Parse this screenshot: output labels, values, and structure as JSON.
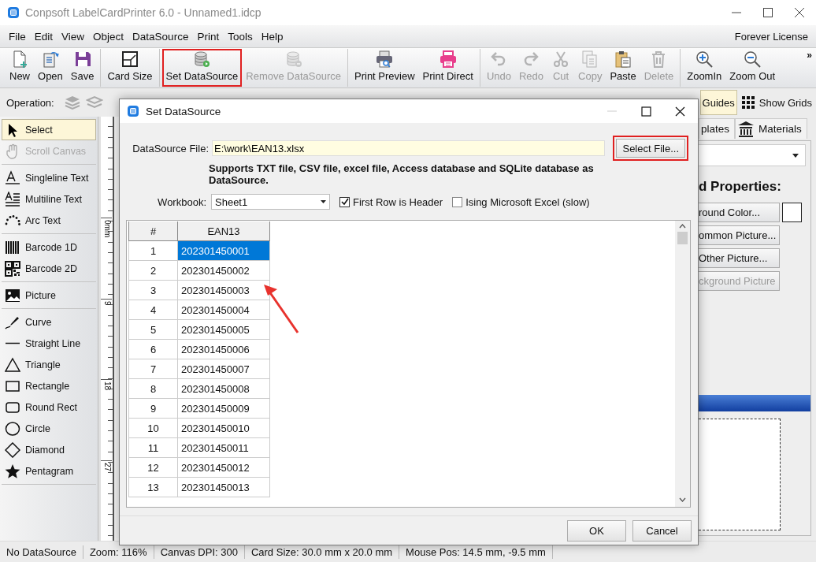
{
  "window": {
    "title": "Conpsoft LabelCardPrinter 6.0 - Unnamed1.idcp"
  },
  "menu": {
    "items": [
      "File",
      "Edit",
      "View",
      "Object",
      "DataSource",
      "Print",
      "Tools",
      "Help"
    ],
    "license": "Forever License"
  },
  "toolbar": {
    "groups": [
      [
        {
          "label": "New",
          "disabled": false,
          "highlighted": false
        },
        {
          "label": "Open",
          "disabled": false,
          "highlighted": false
        },
        {
          "label": "Save",
          "disabled": false,
          "highlighted": false
        }
      ],
      [
        {
          "label": "Card Size",
          "disabled": false,
          "highlighted": false
        }
      ],
      [
        {
          "label": "Set DataSource",
          "disabled": false,
          "highlighted": true
        },
        {
          "label": "Remove DataSource",
          "disabled": true,
          "highlighted": false
        }
      ],
      [
        {
          "label": "Print Preview",
          "disabled": false,
          "highlighted": false
        },
        {
          "label": "Print Direct",
          "disabled": false,
          "highlighted": false
        }
      ],
      [
        {
          "label": "Undo",
          "disabled": true,
          "highlighted": false
        },
        {
          "label": "Redo",
          "disabled": true,
          "highlighted": false
        },
        {
          "label": "Cut",
          "disabled": true,
          "highlighted": false
        },
        {
          "label": "Copy",
          "disabled": true,
          "highlighted": false
        },
        {
          "label": "Paste",
          "disabled": false,
          "highlighted": false
        },
        {
          "label": "Delete",
          "disabled": true,
          "highlighted": false
        }
      ],
      [
        {
          "label": "ZoomIn",
          "disabled": false,
          "highlighted": false
        },
        {
          "label": "Zoom Out",
          "disabled": false,
          "highlighted": false
        }
      ]
    ],
    "overflow": "»"
  },
  "operation_bar": {
    "label": "Operation:",
    "toggles": [
      {
        "label": "Guides",
        "selected": true
      },
      {
        "label": "Show Grids",
        "selected": false
      }
    ]
  },
  "tools": {
    "groups": [
      [
        {
          "label": "Select",
          "selected": true,
          "disabled": false
        },
        {
          "label": "Scroll Canvas",
          "selected": false,
          "disabled": true
        }
      ],
      [
        {
          "label": "Singleline Text",
          "selected": false,
          "disabled": false
        },
        {
          "label": "Multiline Text",
          "selected": false,
          "disabled": false
        },
        {
          "label": "Arc Text",
          "selected": false,
          "disabled": false
        }
      ],
      [
        {
          "label": "Barcode 1D",
          "selected": false,
          "disabled": false
        },
        {
          "label": "Barcode 2D",
          "selected": false,
          "disabled": false
        }
      ],
      [
        {
          "label": "Picture",
          "selected": false,
          "disabled": false
        }
      ],
      [
        {
          "label": "Curve",
          "selected": false,
          "disabled": false
        },
        {
          "label": "Straight Line",
          "selected": false,
          "disabled": false
        },
        {
          "label": "Triangle",
          "selected": false,
          "disabled": false
        },
        {
          "label": "Rectangle",
          "selected": false,
          "disabled": false
        },
        {
          "label": "Round Rect",
          "selected": false,
          "disabled": false
        },
        {
          "label": "Circle",
          "selected": false,
          "disabled": false
        },
        {
          "label": "Diamond",
          "selected": false,
          "disabled": false
        },
        {
          "label": "Pentagram",
          "selected": false,
          "disabled": false
        }
      ]
    ]
  },
  "ruler": {
    "labels": [
      "0mm",
      "9",
      "18",
      "27"
    ]
  },
  "right_panel": {
    "tabs": [
      {
        "label": "plates",
        "selected": false
      },
      {
        "label": "Materials",
        "selected": false
      }
    ],
    "heading": "d Properties:",
    "buttons": [
      {
        "label": "round Color...",
        "disabled": false
      },
      {
        "label": "ommon Picture...",
        "disabled": false
      },
      {
        "label": "Other Picture...",
        "disabled": false
      },
      {
        "label": "ckground Picture",
        "disabled": true
      }
    ]
  },
  "dialog": {
    "title": "Set DataSource",
    "file_label": "DataSource File:",
    "file_value": "E:\\work\\EAN13.xlsx",
    "select_button": {
      "label": "Select File...",
      "highlighted": true
    },
    "note": "Supports TXT file, CSV file, excel file, Access database and SQLite database as DataSource.",
    "workbook_label": "Workbook:",
    "workbook_value": "Sheet1",
    "options": [
      {
        "label": "First Row is Header",
        "checked": true
      },
      {
        "label": "Ising Microsoft Excel (slow)",
        "checked": false
      }
    ],
    "table": {
      "columns": [
        "#",
        "EAN13"
      ],
      "rows": [
        {
          "cells": [
            "1",
            "202301450001"
          ],
          "selected": true
        },
        {
          "cells": [
            "2",
            "202301450002"
          ],
          "selected": false
        },
        {
          "cells": [
            "3",
            "202301450003"
          ],
          "selected": false
        },
        {
          "cells": [
            "4",
            "202301450004"
          ],
          "selected": false
        },
        {
          "cells": [
            "5",
            "202301450005"
          ],
          "selected": false
        },
        {
          "cells": [
            "6",
            "202301450006"
          ],
          "selected": false
        },
        {
          "cells": [
            "7",
            "202301450007"
          ],
          "selected": false
        },
        {
          "cells": [
            "8",
            "202301450008"
          ],
          "selected": false
        },
        {
          "cells": [
            "9",
            "202301450009"
          ],
          "selected": false
        },
        {
          "cells": [
            "10",
            "202301450010"
          ],
          "selected": false
        },
        {
          "cells": [
            "11",
            "202301450011"
          ],
          "selected": false
        },
        {
          "cells": [
            "12",
            "202301450012"
          ],
          "selected": false
        },
        {
          "cells": [
            "13",
            "202301450013"
          ],
          "selected": false
        }
      ]
    },
    "buttons": [
      "OK",
      "Cancel"
    ]
  },
  "status_bar": {
    "items": [
      "No DataSource",
      "Zoom: 116%",
      "Canvas DPI: 300",
      "Card Size: 30.0 mm x 20.0 mm",
      "Mouse Pos: 14.5 mm, -9.5 mm"
    ]
  }
}
